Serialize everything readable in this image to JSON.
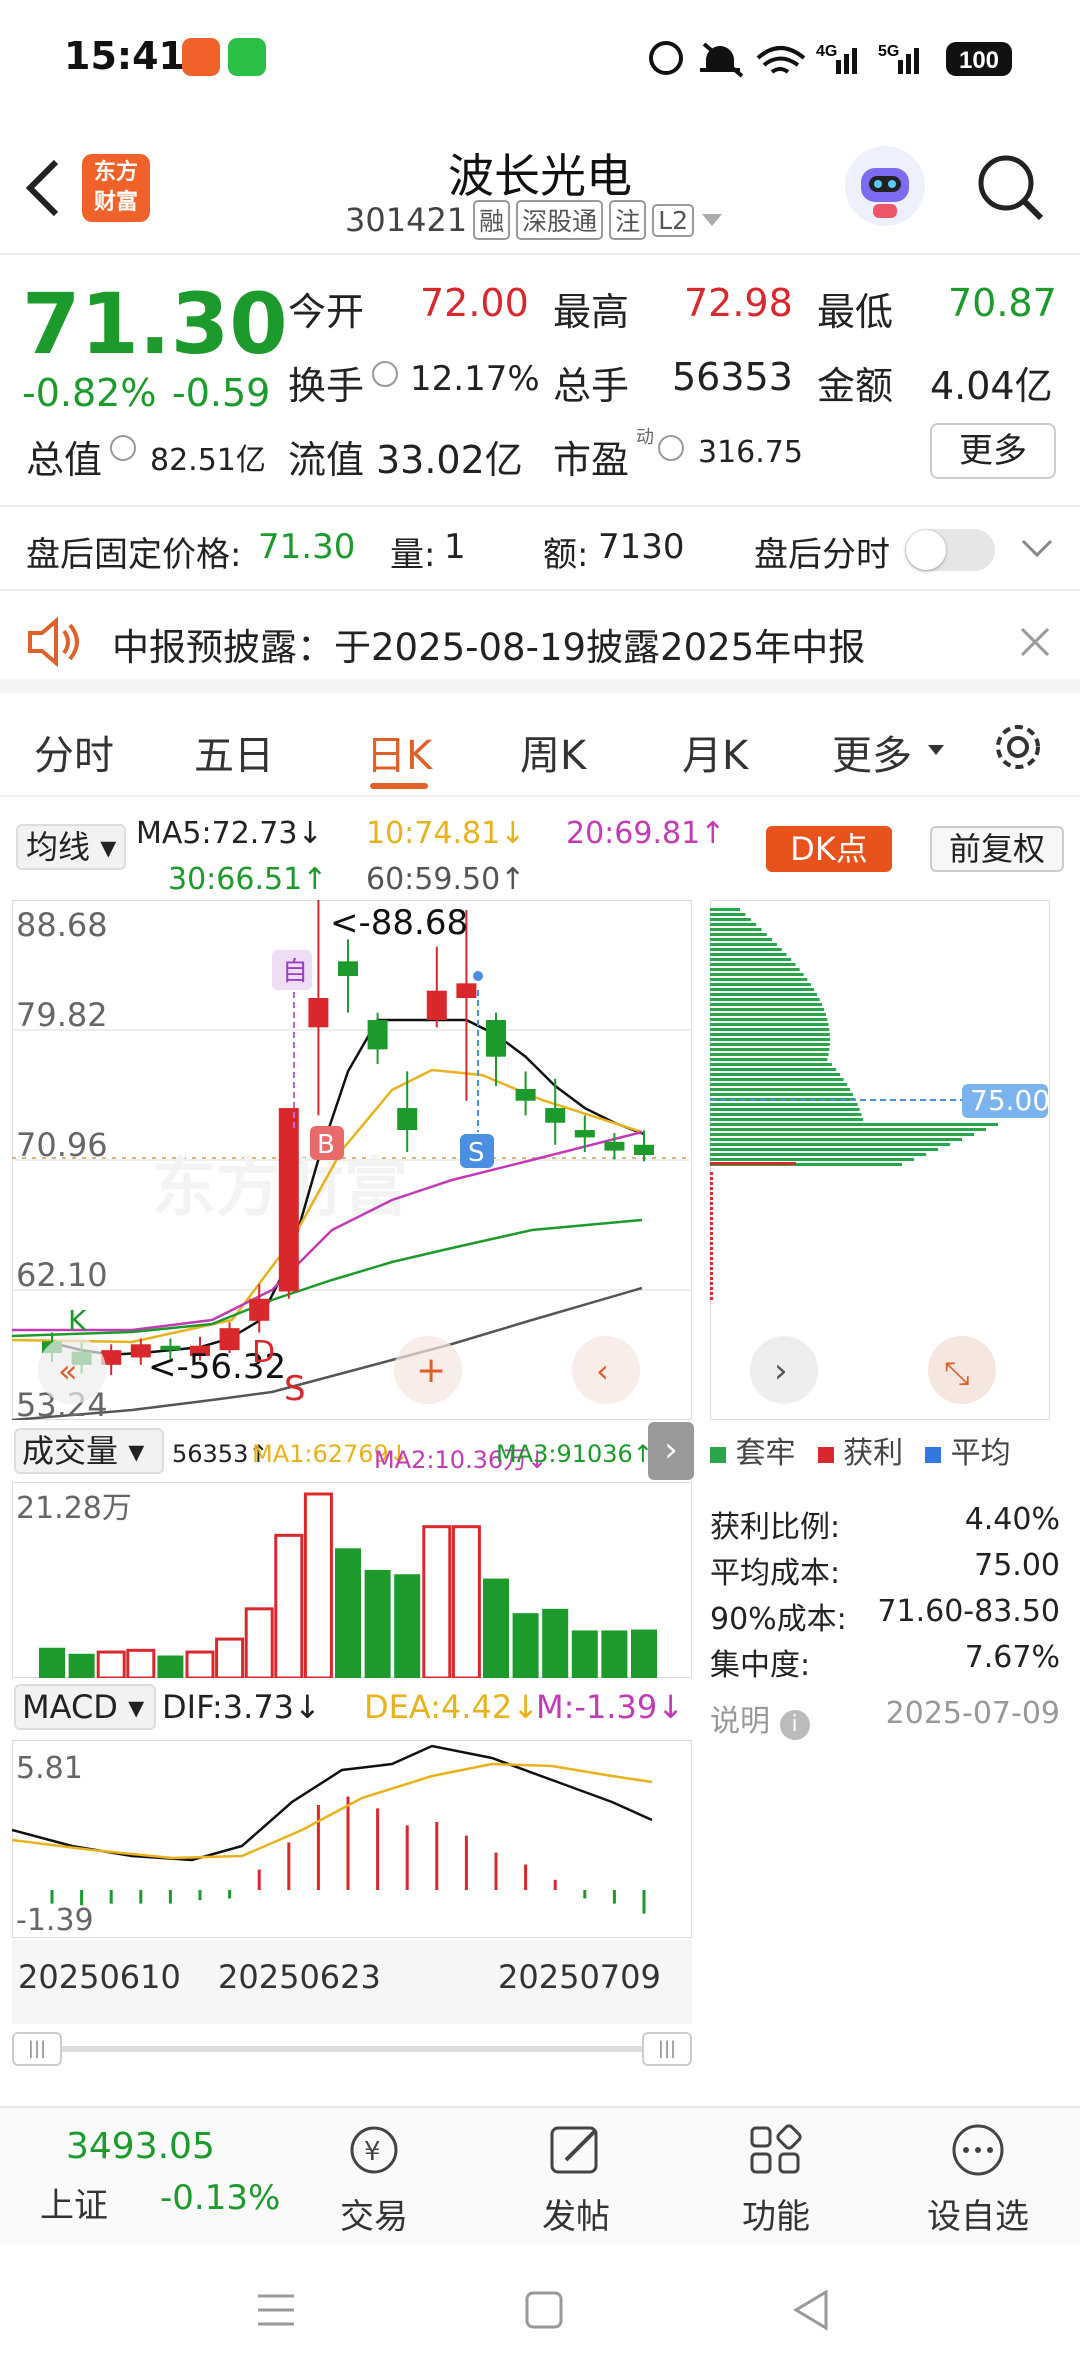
{
  "status_bar": {
    "time": "15:41",
    "battery": "100",
    "net1": "4G",
    "net2": "5G"
  },
  "header": {
    "title": "波长光电",
    "code": "301421",
    "tags": [
      "融",
      "深股通",
      "注",
      "L2"
    ],
    "logo_line1": "东方",
    "logo_line2": "财富"
  },
  "quote": {
    "price": "71.30",
    "change_pct": "-0.82%",
    "change": "-0.59",
    "open_label": "今开",
    "open": "72.00",
    "high_label": "最高",
    "high": "72.98",
    "low_label": "最低",
    "low": "70.87",
    "turnover_label": "换手",
    "turnover": "12.17%",
    "volume_label": "总手",
    "volume": "56353",
    "amount_label": "金额",
    "amount": "4.04亿",
    "mktcap_label": "总值",
    "mktcap": "82.51亿",
    "float_label": "流值",
    "float": "33.02亿",
    "pe_label": "市盈",
    "pe_sup": "动",
    "pe": "316.75",
    "more_label": "更多"
  },
  "after_hours": {
    "price_label": "盘后固定价格:",
    "price": "71.30",
    "vol_label": "量:",
    "vol": "1",
    "amt_label": "额:",
    "amt": "7130",
    "timeshare_label": "盘后分时"
  },
  "notice": {
    "text": "中报预披露：于2025-08-19披露2025年中报"
  },
  "tabs": [
    "分时",
    "五日",
    "日K",
    "周K",
    "月K",
    "更多"
  ],
  "ma": {
    "selector": "均线",
    "ma5": "MA5:72.73↓",
    "ma10": "10:74.81↓",
    "ma20": "20:69.81↑",
    "ma30": "30:66.51↑",
    "ma60": "60:59.50↑",
    "dk": "DK点",
    "fq": "前复权"
  },
  "kline": {
    "y_ticks": [
      "88.68",
      "79.82",
      "70.96",
      "62.10",
      "53.24"
    ],
    "max_label": "<-88.68",
    "min_label": "<-56.32",
    "markers": {
      "self": "自",
      "buy": "B",
      "sell": "S",
      "s2": "S",
      "d": "D",
      "k": "K"
    },
    "watermark": "东方财富"
  },
  "chip": {
    "price_tag": "75.00",
    "legend": [
      "套牢",
      "获利",
      "平均"
    ],
    "rows": [
      {
        "label": "获利比例:",
        "value": "4.40%"
      },
      {
        "label": "平均成本:",
        "value": "75.00"
      },
      {
        "label": "90%成本:",
        "value": "71.60-83.50"
      },
      {
        "label": "集中度:",
        "value": "7.67%"
      }
    ],
    "note": "说明",
    "date": "2025-07-09"
  },
  "volume": {
    "selector": "成交量",
    "vol": "56353↑",
    "ma1": "MA1:62769↓",
    "ma2": "MA2:10.36万↓",
    "ma3": "MA3:91036↑",
    "top": "21.28万"
  },
  "macd": {
    "selector": "MACD",
    "dif": "DIF:3.73↓",
    "dea": "DEA:4.42↓",
    "m": "M:-1.39↓",
    "top": "5.81",
    "bottom": "-1.39"
  },
  "dates": [
    "20250610",
    "20250623",
    "20250709"
  ],
  "index": {
    "value": "3493.05",
    "name": "上证",
    "change": "-0.13%"
  },
  "nav": [
    "交易",
    "发帖",
    "功能",
    "设自选"
  ],
  "chart_data": {
    "type": "candlestick",
    "candles": [
      {
        "o": 58.6,
        "c": 57.8,
        "h": 59.2,
        "l": 57.2,
        "up": false
      },
      {
        "o": 57.9,
        "c": 57.0,
        "h": 58.5,
        "l": 56.4,
        "up": false
      },
      {
        "o": 57.0,
        "c": 58.0,
        "h": 58.4,
        "l": 56.3,
        "up": true
      },
      {
        "o": 57.5,
        "c": 58.4,
        "h": 58.8,
        "l": 57.0,
        "up": true
      },
      {
        "o": 58.3,
        "c": 58.0,
        "h": 58.8,
        "l": 57.4,
        "up": false
      },
      {
        "o": 57.6,
        "c": 58.3,
        "h": 58.9,
        "l": 57.3,
        "up": true
      },
      {
        "o": 58.0,
        "c": 59.5,
        "h": 59.9,
        "l": 57.8,
        "up": true
      },
      {
        "o": 60.0,
        "c": 61.5,
        "h": 62.5,
        "l": 59.2,
        "up": true
      },
      {
        "o": 62.0,
        "c": 74.5,
        "h": 74.5,
        "l": 61.5,
        "up": true
      },
      {
        "o": 80.0,
        "c": 82.0,
        "h": 88.68,
        "l": 74.0,
        "up": true
      },
      {
        "o": 84.5,
        "c": 83.5,
        "h": 86.0,
        "l": 81.0,
        "up": false
      },
      {
        "o": 80.5,
        "c": 78.5,
        "h": 81.0,
        "l": 77.5,
        "up": false
      },
      {
        "o": 74.5,
        "c": 73.0,
        "h": 77.0,
        "l": 71.5,
        "up": false
      },
      {
        "o": 80.5,
        "c": 82.5,
        "h": 85.5,
        "l": 80.0,
        "up": true
      },
      {
        "o": 82.0,
        "c": 83.0,
        "h": 88.0,
        "l": 75.0,
        "up": true
      },
      {
        "o": 80.5,
        "c": 78.0,
        "h": 81.0,
        "l": 76.0,
        "up": false
      },
      {
        "o": 75.8,
        "c": 75.0,
        "h": 77.0,
        "l": 74.0,
        "up": false
      },
      {
        "o": 74.5,
        "c": 73.5,
        "h": 76.5,
        "l": 72.0,
        "up": false
      },
      {
        "o": 73.0,
        "c": 72.5,
        "h": 74.0,
        "l": 71.5,
        "up": false
      },
      {
        "o": 72.2,
        "c": 71.6,
        "h": 72.8,
        "l": 71.0,
        "up": false
      },
      {
        "o": 72.0,
        "c": 71.3,
        "h": 72.98,
        "l": 70.87,
        "up": false
      }
    ],
    "volumes": [
      3.5,
      2.8,
      3.0,
      3.2,
      2.6,
      3.0,
      4.5,
      8.0,
      16.5,
      21.28,
      15.0,
      12.5,
      12.0,
      17.5,
      17.5,
      11.5,
      7.5,
      8.0,
      5.5,
      5.5,
      5.6
    ],
    "macd_hist": [
      -0.8,
      -0.9,
      -0.8,
      -0.8,
      -0.8,
      -0.6,
      -0.5,
      1.2,
      2.8,
      5.0,
      5.5,
      4.8,
      3.8,
      4.0,
      3.2,
      2.2,
      1.5,
      0.6,
      -0.5,
      -0.8,
      -1.39
    ],
    "ma5": [
      58.5,
      58.0,
      57.7,
      57.8,
      58.0,
      58.2,
      58.8,
      60.0,
      64.0,
      71.0,
      77.0,
      80.5,
      80.5,
      80.5,
      80.5,
      79.5,
      78.0,
      76.0,
      74.5,
      73.5,
      72.73
    ]
  }
}
